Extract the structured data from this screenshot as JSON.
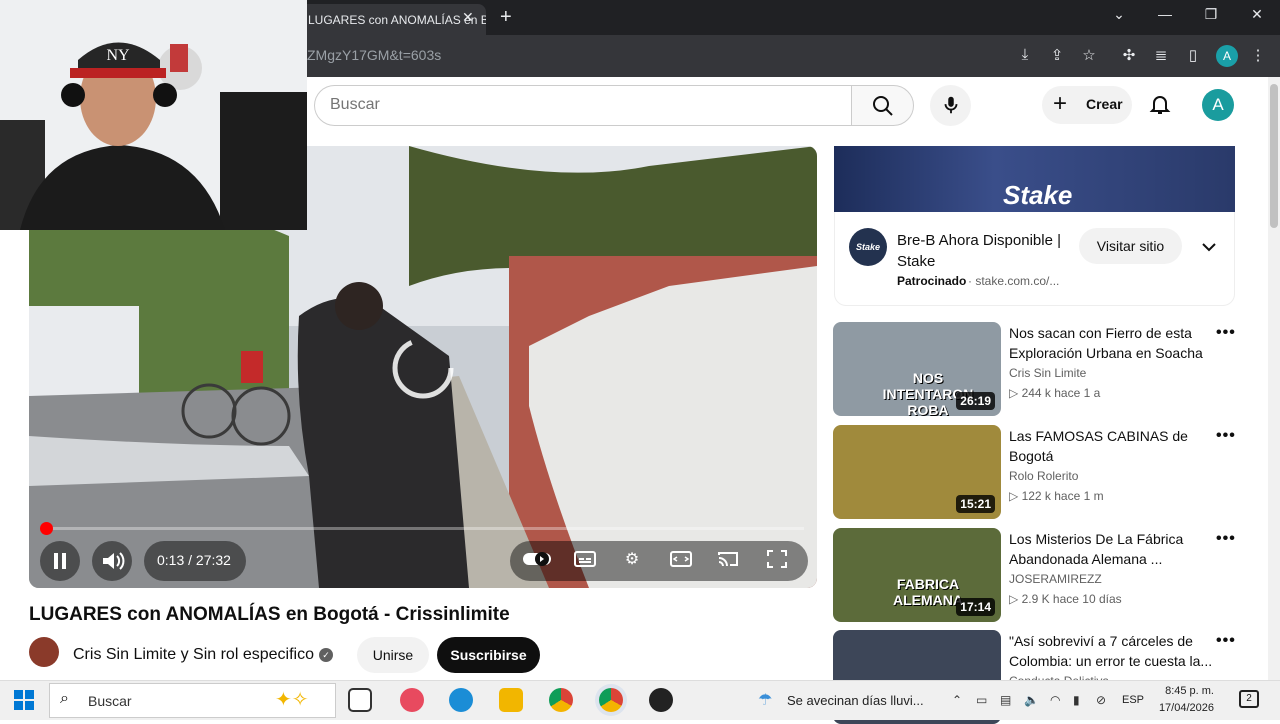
{
  "browser": {
    "tab_title": "LUGARES con ANOMALÍAS en Bogotá",
    "url": "ZMgzY17GM&t=603s",
    "profile_initial": "A"
  },
  "header": {
    "search_placeholder": "Buscar",
    "create_label": "Crear",
    "avatar_initial": "A"
  },
  "player": {
    "time": "0:13 / 27:32",
    "progress": 0.008
  },
  "video": {
    "title": "LUGARES con ANOMALÍAS en Bogotá - Crissinlimite",
    "channel": "Cris Sin Limite y Sin rol especifico",
    "join_label": "Unirse",
    "subscribe_label": "Suscribirse"
  },
  "ad": {
    "brand": "Stake",
    "title": "Bre-B Ahora Disponible | Stake",
    "sponsored": "Patrocinado",
    "domain": "· stake.com.co/...",
    "visit_label": "Visitar sitio"
  },
  "recommendations": [
    {
      "title": "Nos sacan con Fierro de esta Exploración Urbana en Soacha",
      "channel": "Cris Sin Limite",
      "meta": "▷ 244 k  hace 1 a",
      "duration": "26:19",
      "thumb_text": "NOS INTENTARON ROBA",
      "color": "#8f9aa3"
    },
    {
      "title": "Las FAMOSAS CABINAS de Bogotá",
      "channel": "Rolo Rolerito",
      "meta": "▷ 122 k  hace 1 m",
      "duration": "15:21",
      "thumb_text": "",
      "color": "#a08a3c"
    },
    {
      "title": "Los Misterios De La Fábrica Abandonada Alemana ...",
      "channel": "JOSERAMIREZZ",
      "meta": "▷ 2.9 K  hace 10 días",
      "duration": "17:14",
      "thumb_text": "FABRICA ALEMANA",
      "color": "#5c6b3a"
    },
    {
      "title": "\"Así sobreviví a 7 cárceles de Colombia: un error te cuesta la...",
      "channel": "Conducta Delictiva",
      "meta": "",
      "duration": "",
      "thumb_text": "",
      "color": "#3d4658"
    }
  ],
  "taskbar": {
    "search_label": "Buscar",
    "weather": "Se avecinan días lluvi...",
    "lang": "ESP",
    "time": "8:45 p. m.",
    "date": "17/04/2026",
    "notif_count": "2"
  }
}
